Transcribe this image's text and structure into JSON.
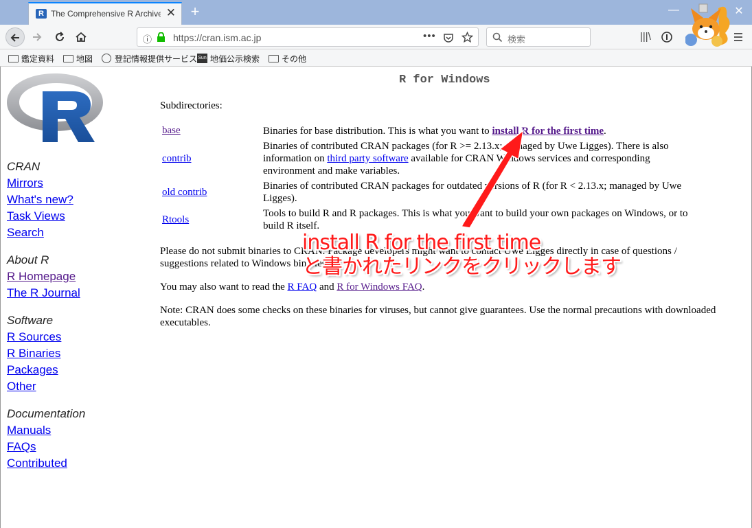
{
  "browser": {
    "tab_title": "The Comprehensive R Archive N",
    "tab_favicon": "R",
    "tab_close": "✕",
    "new_tab": "+",
    "url": "https://cran.ism.ac.jp",
    "search_placeholder": "検索",
    "url_more": "•••",
    "minimize": "—",
    "close": "✕"
  },
  "bookmarks": [
    {
      "label": "鑑定資料",
      "icon": "folder-icon"
    },
    {
      "label": "地図",
      "icon": "folder-icon"
    },
    {
      "label": "登記情報提供サービス",
      "icon": "globe-icon"
    },
    {
      "label": "地価公示検索",
      "icon": "sun-icon"
    },
    {
      "label": "その他",
      "icon": "folder-icon"
    }
  ],
  "sun_icon_text": "Sun",
  "page": {
    "heading": "R for Windows",
    "subdirectories_label": "Subdirectories:",
    "subdirs": [
      {
        "name": "base",
        "desc_before": "Binaries for base distribution. This is what you want to ",
        "desc_link": "install R for the first time",
        "desc_after": "."
      },
      {
        "name": "contrib",
        "desc_before": "Binaries of contributed CRAN packages (for R >= 2.13.x; managed by Uwe Ligges). There is also information on ",
        "desc_link": "third party software",
        "desc_after": " available for CRAN Windows services and corresponding environment and make variables."
      },
      {
        "name": "old contrib",
        "desc_before": "Binaries of contributed CRAN packages for outdated versions of R (for R < 2.13.x; managed by Uwe Ligges).",
        "desc_link": "",
        "desc_after": ""
      },
      {
        "name": "Rtools",
        "desc_before": "Tools to build R and R packages. This is what you want to build your own packages on Windows, or to build R itself.",
        "desc_link": "",
        "desc_after": ""
      }
    ],
    "para1": "Please do not submit binaries to CRAN. Package developers might want to contact Uwe Ligges directly in case of questions / suggestions related to Windows binaries.",
    "para2_before": "You may also want to read the ",
    "para2_link1": "R FAQ",
    "para2_mid": " and ",
    "para2_link2": "R for Windows FAQ",
    "para2_after": ".",
    "para3": "Note: CRAN does some checks on these binaries for viruses, but cannot give guarantees. Use the normal precautions with downloaded executables."
  },
  "sidebar": {
    "sections": [
      {
        "title": "CRAN",
        "links": [
          "Mirrors",
          "What's new?",
          "Task Views",
          "Search"
        ]
      },
      {
        "title": "About R",
        "links": [
          "R Homepage",
          "The R Journal"
        ]
      },
      {
        "title": "Software",
        "links": [
          "R Sources",
          "R Binaries",
          "Packages",
          "Other"
        ]
      },
      {
        "title": "Documentation",
        "links": [
          "Manuals",
          "FAQs",
          "Contributed"
        ]
      }
    ]
  },
  "annotation": {
    "line1": "install R for the first time",
    "line2": "と書かれたリンクをクリックします",
    "color": "#ff1a1a"
  }
}
